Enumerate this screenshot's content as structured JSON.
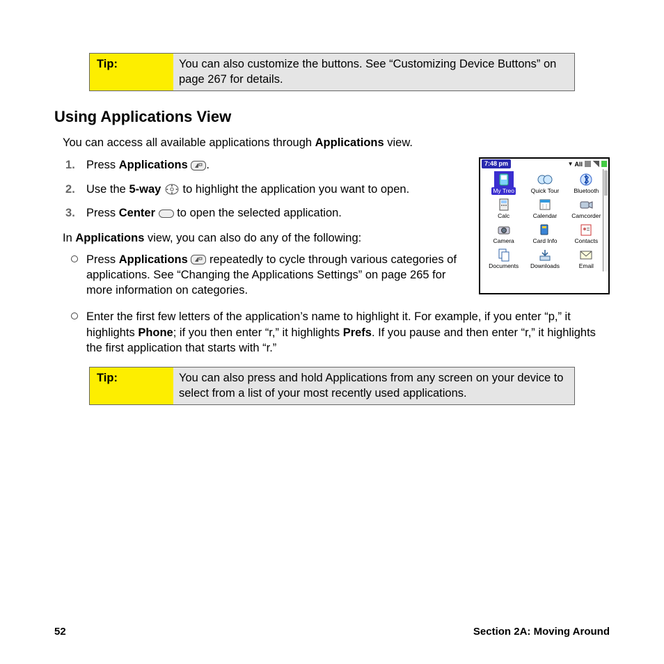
{
  "tip1": {
    "label": "Tip:",
    "text": "You can also customize the buttons. See “Customizing Device Buttons” on page 267 for details."
  },
  "heading": "Using Applications View",
  "intro": {
    "pre": "You can access all available applications through ",
    "strong": "Applications",
    "post": " view."
  },
  "step1": {
    "pre": "Press ",
    "strong": "Applications",
    "post": "."
  },
  "step2": {
    "pre": "Use the ",
    "strong": "5-way",
    "post": " to highlight the application you want to open."
  },
  "step3": {
    "pre": "Press ",
    "strong": "Center",
    "post": " to open the selected application."
  },
  "afterSteps": {
    "pre": "In ",
    "strong": "Applications",
    "post": " view, you can also do any of the following:"
  },
  "bullet1": {
    "pre": "Press ",
    "strong": "Applications",
    "post": " repeatedly to cycle through various categories of applications. See “Changing the Applications Settings” on page 265 for more information on categories."
  },
  "bullet2": {
    "a": "Enter the first few letters of the application’s name to highlight it. For example, if you enter “p,” it highlights ",
    "b": "Phone",
    "c": "; if you then enter “r,” it highlights ",
    "d": "Prefs",
    "e": ". If you pause and then enter “r,” it highlights the first application that starts with “r.”"
  },
  "tip2": {
    "label": "Tip:",
    "text": "You can also press and hold Applications from any screen on your device to select from a list of your most recently used applications."
  },
  "screenshot": {
    "time": "7:48 pm",
    "categoryLabel": "All",
    "apps": [
      "My Treo",
      "Quick Tour",
      "Bluetooth",
      "Calc",
      "Calendar",
      "Camcorder",
      "Camera",
      "Card Info",
      "Contacts",
      "Documents",
      "Downloads",
      "Email"
    ]
  },
  "footer": {
    "page": "52",
    "section": "Section 2A: Moving Around"
  }
}
